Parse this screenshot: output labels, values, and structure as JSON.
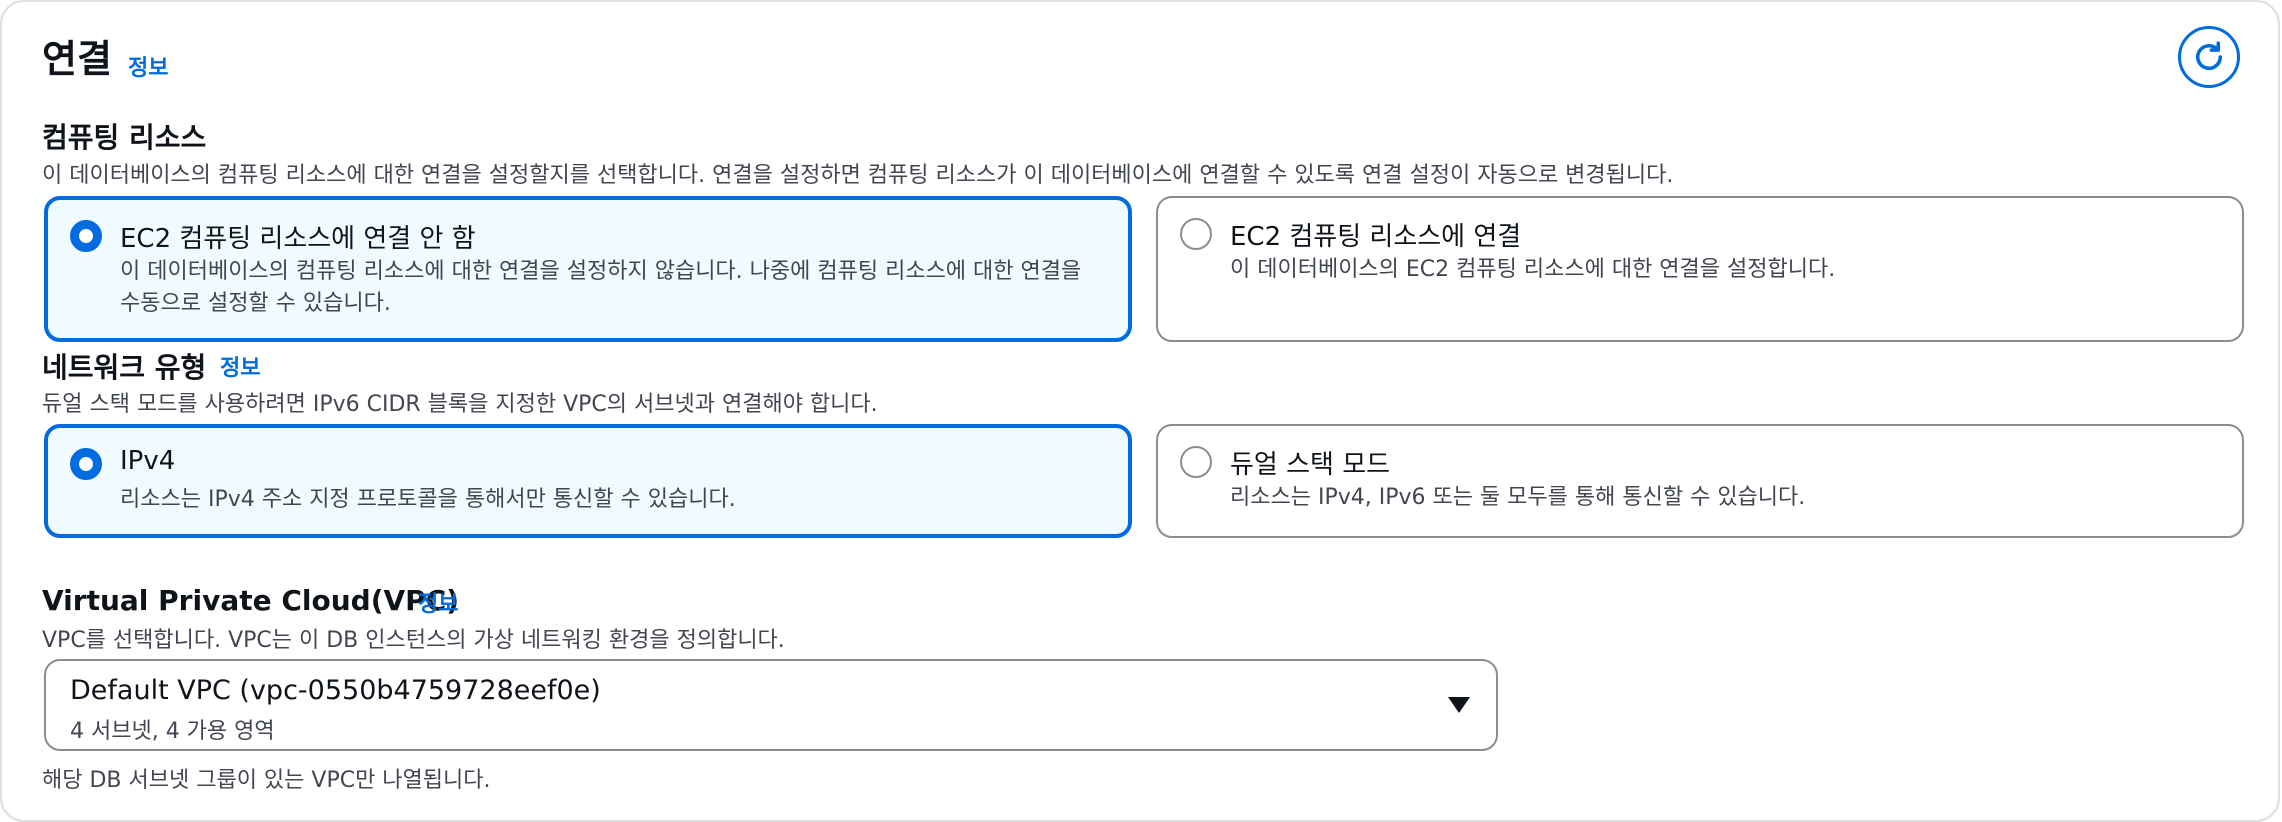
{
  "section": {
    "title": "연결",
    "info": "정보"
  },
  "compute": {
    "label": "컴퓨팅 리소스",
    "description": "이 데이터베이스의 컴퓨팅 리소스에 대한 연결을 설정할지를 선택합니다. 연결을 설정하면 컴퓨팅 리소스가 이 데이터베이스에 연결할 수 있도록 연결 설정이 자동으로 변경됩니다.",
    "options": [
      {
        "label": "EC2 컴퓨팅 리소스에 연결 안 함",
        "desc_line1": "이 데이터베이스의 컴퓨팅 리소스에 대한 연결을 설정하지 않습니다. 나중에 컴퓨팅 리소스에 대한 연결을",
        "desc_line2": "수동으로 설정할 수 있습니다.",
        "selected": true
      },
      {
        "label": "EC2 컴퓨팅 리소스에 연결",
        "desc_line1": "이 데이터베이스의 EC2 컴퓨팅 리소스에 대한 연결을 설정합니다.",
        "selected": false
      }
    ]
  },
  "network": {
    "label": "네트워크 유형",
    "info": "정보",
    "description": "듀얼 스택 모드를 사용하려면 IPv6 CIDR 블록을 지정한 VPC의 서브넷과 연결해야 합니다.",
    "options": [
      {
        "label": "IPv4",
        "desc": "리소스는 IPv4 주소 지정 프로토콜을 통해서만 통신할 수 있습니다.",
        "selected": true
      },
      {
        "label": "듀얼 스택 모드",
        "desc": "리소스는 IPv4, IPv6 또는 둘 모두를 통해 통신할 수 있습니다.",
        "selected": false
      }
    ]
  },
  "vpc": {
    "label": "Virtual Private Cloud(VPC)",
    "info": "정보",
    "description": "VPC를 선택합니다. VPC는 이 DB 인스턴스의 가상 네트워킹 환경을 정의합니다.",
    "selected_value": "Default VPC (vpc-0550b4759728eef0e)",
    "selected_detail": "4 서브넷, 4 가용 영역",
    "hint": "해당 DB 서브넷 그룹이 있는 VPC만 나열됩니다."
  },
  "colors": {
    "accent": "#006ce0",
    "selected_bg": "#f0fbff",
    "border": "#8c8c94"
  },
  "icons": {
    "refresh": "refresh-icon",
    "dropdown": "caret-down-icon"
  }
}
